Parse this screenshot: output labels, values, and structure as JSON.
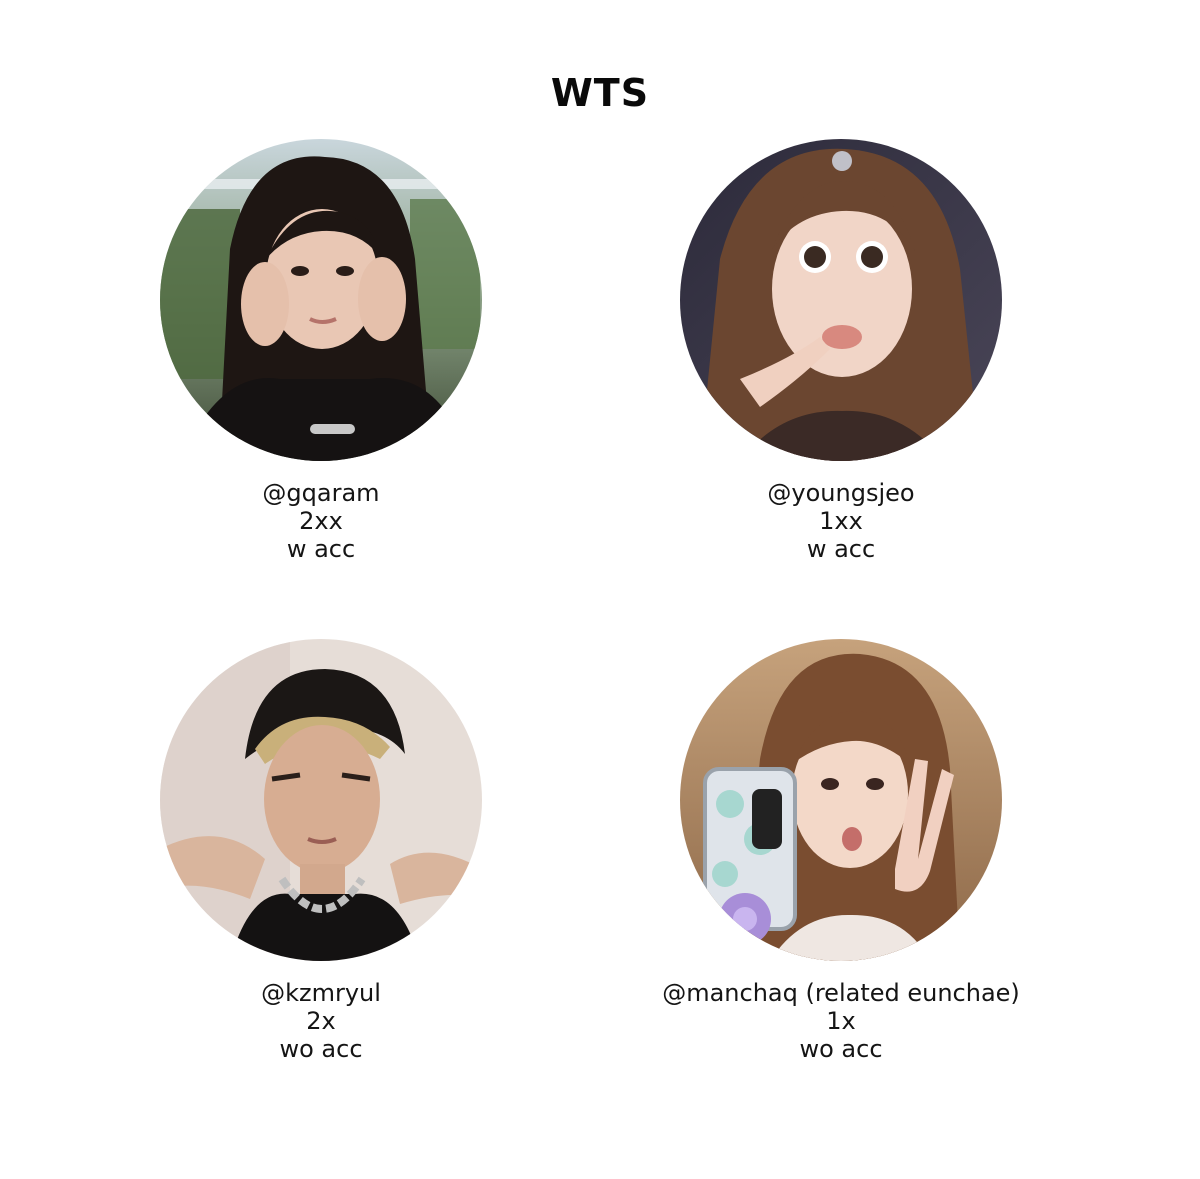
{
  "header": {
    "title": "WTS"
  },
  "listings": [
    {
      "handle": "@gqaram",
      "price": "2xx",
      "account": "w acc"
    },
    {
      "handle": "@youngsjeo",
      "price": "1xx",
      "account": "w acc"
    },
    {
      "handle": "@kzmryul",
      "price": "2x",
      "account": "wo acc"
    },
    {
      "handle": "@manchaq (related eunchae)",
      "price": "1x",
      "account": "wo acc"
    }
  ]
}
